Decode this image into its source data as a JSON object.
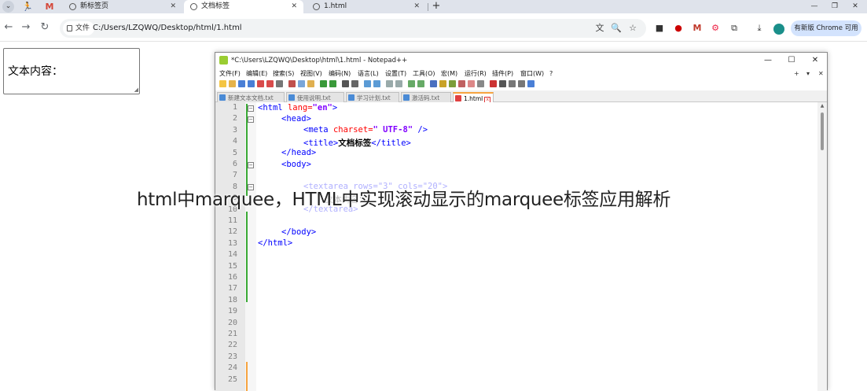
{
  "browser": {
    "tabs": [
      {
        "title": "新标签页"
      },
      {
        "title": "文档标签",
        "active": true
      },
      {
        "title": "1.html"
      }
    ],
    "new_tab_label": "+",
    "window_controls": {
      "minimize": "—",
      "restore": "❐",
      "close": "✕"
    },
    "address": {
      "page_chip": "文件",
      "url": "C:/Users/LZQWQ/Desktop/html/1.html"
    },
    "chrome_button_label": "有新版 Chrome 可用"
  },
  "page": {
    "textarea_text": "文本内容："
  },
  "notepad": {
    "title": "*C:\\Users\\LZQWQ\\Desktop\\html\\1.html - Notepad++",
    "menu": [
      "文件(F)",
      "编辑(E)",
      "搜索(S)",
      "视图(V)",
      "编码(N)",
      "语言(L)",
      "设置(T)",
      "工具(O)",
      "宏(M)",
      "运行(R)",
      "插件(P)",
      "窗口(W)",
      "?"
    ],
    "menu_right": [
      "+",
      "▾",
      "✕"
    ],
    "tabs": [
      {
        "name": "新建文本文档.txt"
      },
      {
        "name": "使用说明.txt"
      },
      {
        "name": "学习计划.txt"
      },
      {
        "name": "激活码.txt"
      },
      {
        "name": "1.html",
        "active": true
      }
    ],
    "line_numbers": [
      "1",
      "2",
      "3",
      "4",
      "5",
      "6",
      "7",
      "8",
      "9",
      "10",
      "11",
      "12",
      "13",
      "14",
      "15",
      "16",
      "17",
      "18",
      "19",
      "20",
      "21",
      "22",
      "23",
      "24",
      "25"
    ],
    "code": {
      "l1": {
        "open": "<html ",
        "attr": "lang=",
        "val": "\"en\"",
        "close": ">"
      },
      "l2": "<head>",
      "l3": {
        "open": "<meta ",
        "attr": "charset=",
        "val": "\" UTF-8\"",
        "close": " />"
      },
      "l4": {
        "open": "<title>",
        "text": "文档标签",
        "close": "</title>"
      },
      "l5": "</head>",
      "l6": "<body>",
      "l8": "<textarea rows=\"3\" cols=\"20\">",
      "l9": "文本内容：",
      "l10": "</textarea>",
      "l12": "</body>",
      "l13": "</html>"
    }
  },
  "caption": "html中marquee，HTML中实现滚动显示的marquee标签应用解析",
  "colors": {
    "tag": "#0000ff",
    "attr": "#ff0000",
    "value": "#8000ff",
    "change_bar_saved": "#3aaa35",
    "change_bar_unsaved": "#f7a440"
  }
}
